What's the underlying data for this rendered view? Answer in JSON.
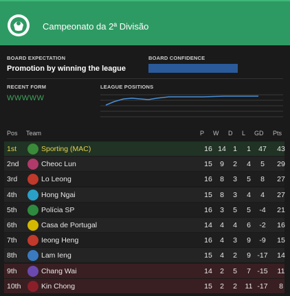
{
  "header": {
    "competition": "Campeonato da 2ª Divisão"
  },
  "board": {
    "expectation_label": "BOARD EXPECTATION",
    "expectation_value": "Promotion by winning the league",
    "confidence_label": "BOARD CONFIDENCE"
  },
  "form": {
    "label": "RECENT FORM",
    "value": "WWWWW"
  },
  "positions": {
    "label": "LEAGUE POSITIONS"
  },
  "table": {
    "headers": {
      "pos": "Pos",
      "team": "Team",
      "p": "P",
      "w": "W",
      "d": "D",
      "l": "L",
      "gd": "GD",
      "pts": "Pts"
    },
    "rows": [
      {
        "pos": "1st",
        "team": "Sporting (MAC)",
        "p": "16",
        "w": "14",
        "d": "1",
        "l": "1",
        "gd": "47",
        "pts": "43"
      },
      {
        "pos": "2nd",
        "team": "Cheoc Lun",
        "p": "15",
        "w": "9",
        "d": "2",
        "l": "4",
        "gd": "5",
        "pts": "29"
      },
      {
        "pos": "3rd",
        "team": "Lo Leong",
        "p": "16",
        "w": "8",
        "d": "3",
        "l": "5",
        "gd": "8",
        "pts": "27"
      },
      {
        "pos": "4th",
        "team": "Hong Ngai",
        "p": "15",
        "w": "8",
        "d": "3",
        "l": "4",
        "gd": "4",
        "pts": "27"
      },
      {
        "pos": "5th",
        "team": "Polícia SP",
        "p": "16",
        "w": "3",
        "d": "5",
        "l": "5",
        "gd": "-4",
        "pts": "21"
      },
      {
        "pos": "6th",
        "team": "Casa de Portugal",
        "p": "14",
        "w": "4",
        "d": "4",
        "l": "6",
        "gd": "-2",
        "pts": "16"
      },
      {
        "pos": "7th",
        "team": "Ieong Heng",
        "p": "16",
        "w": "4",
        "d": "3",
        "l": "9",
        "gd": "-9",
        "pts": "15"
      },
      {
        "pos": "8th",
        "team": "Lam Ieng",
        "p": "15",
        "w": "4",
        "d": "2",
        "l": "9",
        "gd": "-17",
        "pts": "14"
      },
      {
        "pos": "9th",
        "team": "Chang Wai",
        "p": "14",
        "w": "2",
        "d": "5",
        "l": "7",
        "gd": "-15",
        "pts": "11"
      },
      {
        "pos": "10th",
        "team": "Kin Chong",
        "p": "15",
        "w": "2",
        "d": "2",
        "l": "11",
        "gd": "-17",
        "pts": "8"
      }
    ]
  },
  "colors": {
    "header_green": "#2e9a63",
    "highlight_yellow": "#e8d24a",
    "promotion_row": "#203324",
    "relegation_row": "#3a1f22",
    "confidence_blue": "#2a5a9a",
    "form_green": "#3fa35a"
  }
}
